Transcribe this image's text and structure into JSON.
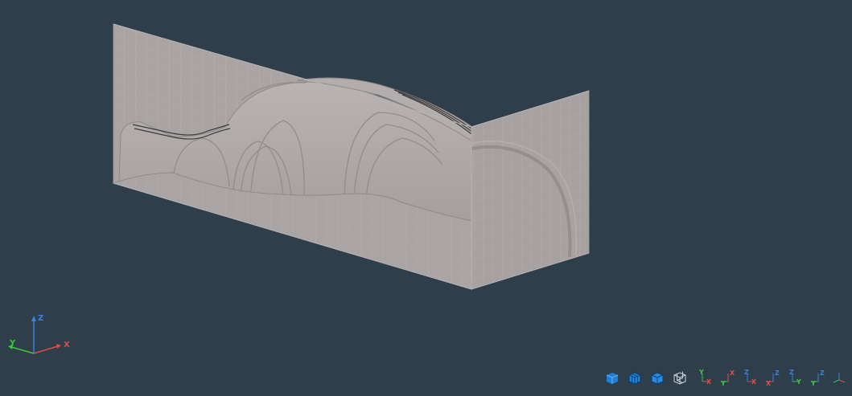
{
  "viewport": {
    "background": "#2e3f4b",
    "model_face_color": "#a9a3a3",
    "model_edge_color": "#8f8a8a",
    "grid_color": "#cfcaca"
  },
  "triad": {
    "x_label": "X",
    "y_label": "Y",
    "z_label": "Z",
    "x_color": "#e04a4a",
    "y_color": "#3fc43f",
    "z_color": "#3f7fe0"
  },
  "view_toolbar": {
    "buttons": [
      {
        "name": "view-shaded-icon"
      },
      {
        "name": "view-shaded-edges-icon"
      },
      {
        "name": "view-hidden-line-icon"
      },
      {
        "name": "view-wireframe-icon"
      },
      {
        "name": "view-front-xy-icon",
        "a": "Y",
        "b": "X"
      },
      {
        "name": "view-back-xy-icon",
        "a": "X",
        "b": "Y"
      },
      {
        "name": "view-top-xz-icon",
        "a": "Z",
        "b": "X"
      },
      {
        "name": "view-bottom-xz-icon",
        "a": "Z",
        "b": "X"
      },
      {
        "name": "view-right-yz-icon",
        "a": "Z",
        "b": "Y"
      },
      {
        "name": "view-left-yz-icon",
        "a": "Z",
        "b": "Y"
      },
      {
        "name": "view-isometric-icon"
      }
    ]
  }
}
